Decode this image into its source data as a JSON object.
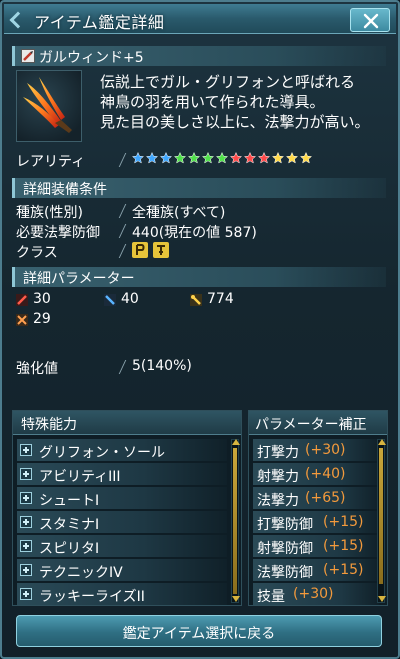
{
  "window": {
    "title": "アイテム鑑定詳細",
    "close_glyph": "✕"
  },
  "item": {
    "name": "ガルウィンド+5",
    "description_lines": [
      "伝説上でガル・グリフォンと呼ばれる",
      "神鳥の羽を用いて作られた導具。",
      "見た目の美しさ以上に、法撃力が高い。"
    ]
  },
  "rarity": {
    "label": "レアリティ",
    "star_count": 13,
    "star_colors": [
      "#3fa7ff",
      "#3fa7ff",
      "#3fa7ff",
      "#4fe04a",
      "#4fe04a",
      "#4fe04a",
      "#4fe04a",
      "#ff4a4a",
      "#ff4a4a",
      "#ff4a4a",
      "#ffd94a",
      "#ffd94a",
      "#ffd94a"
    ]
  },
  "conditions": {
    "section_title": "詳細装備条件",
    "race_label": "種族(性別)",
    "race_value": "全種族(すべて)",
    "req_label": "必要法撃防御",
    "req_value": "440(現在の値 587)",
    "class_label": "クラス",
    "class_icons": [
      "force-class-icon",
      "techter-class-icon"
    ]
  },
  "parameters": {
    "section_title": "詳細パラメーター",
    "stats": [
      {
        "icon": "melee-attack-icon",
        "value": "30"
      },
      {
        "icon": "ranged-attack-icon",
        "value": "40"
      },
      {
        "icon": "technique-attack-icon",
        "value": "774"
      },
      {
        "icon": "dexterity-icon",
        "value": "29"
      }
    ]
  },
  "enhance": {
    "label": "強化値",
    "value": "5(140%)"
  },
  "abilities": {
    "title": "特殊能力",
    "items": [
      "グリフォン・ソール",
      "アビリティIII",
      "シュートI",
      "スタミナI",
      "スピリタI",
      "テクニックIV",
      "ラッキーライズII"
    ]
  },
  "bonuses": {
    "title": "パラメーター補正",
    "items": [
      {
        "key": "打撃力",
        "value": "(+30)"
      },
      {
        "key": "射撃力",
        "value": "(+40)"
      },
      {
        "key": "法撃力",
        "value": "(+65)"
      },
      {
        "key": "打撃防御",
        "value": "(+15)"
      },
      {
        "key": "射撃防御",
        "value": "(+15)"
      },
      {
        "key": "法撃防御",
        "value": "(+15)"
      },
      {
        "key": "技量",
        "value": "(+30)"
      }
    ]
  },
  "footer": {
    "back_label": "鑑定アイテム選択に戻る"
  },
  "colors": {
    "accent": "#4d9bb1",
    "bonus_value": "#f39a3c"
  }
}
